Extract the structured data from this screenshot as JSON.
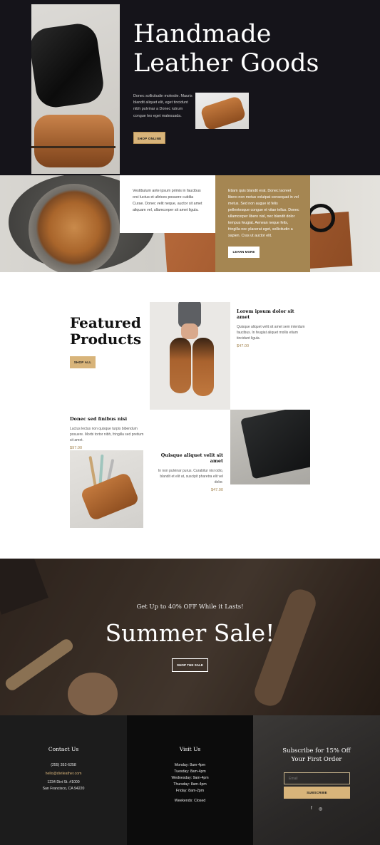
{
  "hero": {
    "title_line1": "Handmade",
    "title_line2": "Leather Goods",
    "text": "Donec sollicitudin molestie. Mauris blandit aliquet elit, eget tincidunt nibh pulvinar a Donec rutrum congue leo eget malesuada.",
    "button": "SHOP ONLINE"
  },
  "band": {
    "white_card_text": "Vestibulum ante ipsum primis in faucibus orci luctus et ultrices posuere cubilia Curae. Donec velit neque, auctor sit amet aliquam vel, ullamcorper sit amet ligula.",
    "gold_card_text": "Etiam quis blandit erat. Donec laoreet libero non metus volutpat consequat in vel metus. Sed non augue id felis pellentesque congue et vitae tellus. Donec ullamcorper libero nisl, nec blandit dolor tempus feugiat. Aenean neque felis, fringilla nec placerat eget, sollicitudin a sapien. Cras ut auctor elit.",
    "button": "LEARN MORE"
  },
  "featured": {
    "title_line1": "Featured",
    "title_line2": "Products",
    "button": "SHOP ALL",
    "products": [
      {
        "name": "Lorem ipsum dolor sit amet",
        "desc": "Quisque aliquet velit sit amet sem interdum faucibus. In feugiat aliquet mollis etiam tincidunt ligula.",
        "price": "$47.00"
      },
      {
        "name": "Donec sed finibus nisi",
        "desc": "Luctus lectus non quisque turpis bibendum posuere. Morbi tortor nibh, fringilla sed pretium sit amet.",
        "price": "$97.00"
      },
      {
        "name": "Quisque aliquet velit sit amet",
        "desc": "In non pulvinar purus. Curabitur nisi odio, blandit et elit at, suscipit pharetra elit vel dolor.",
        "price": "$47.00"
      }
    ]
  },
  "sale": {
    "pre": "Get Up to 40% OFF While it Lasts!",
    "title": "Summer Sale!",
    "button": "SHOP THE SALE"
  },
  "footer": {
    "contact": {
      "heading": "Contact Us",
      "phone": "(255) 352-6258",
      "email": "hello@divileather.com",
      "address1": "1234 Divi St. #1000",
      "address2": "San Francisco, CA 94220"
    },
    "visit": {
      "heading": "Visit Us",
      "hours": [
        "Monday: 8am-4pm",
        "Tuesday: 8am-4pm",
        "Wednesday: 9am-4pm",
        "Thursday: 8am-4pm",
        "Friday: 8am-2pm"
      ],
      "weekend": "Weekends: Closed"
    },
    "subscribe": {
      "heading_line1": "Subscribe for 15% Off",
      "heading_line2": "Your First Order",
      "placeholder": "Email",
      "button": "SUBSCRIBE",
      "social": [
        "f",
        "◎"
      ]
    }
  },
  "colors": {
    "dark": "#15141a",
    "gold": "#d8b47a",
    "tan": "#a58652"
  }
}
